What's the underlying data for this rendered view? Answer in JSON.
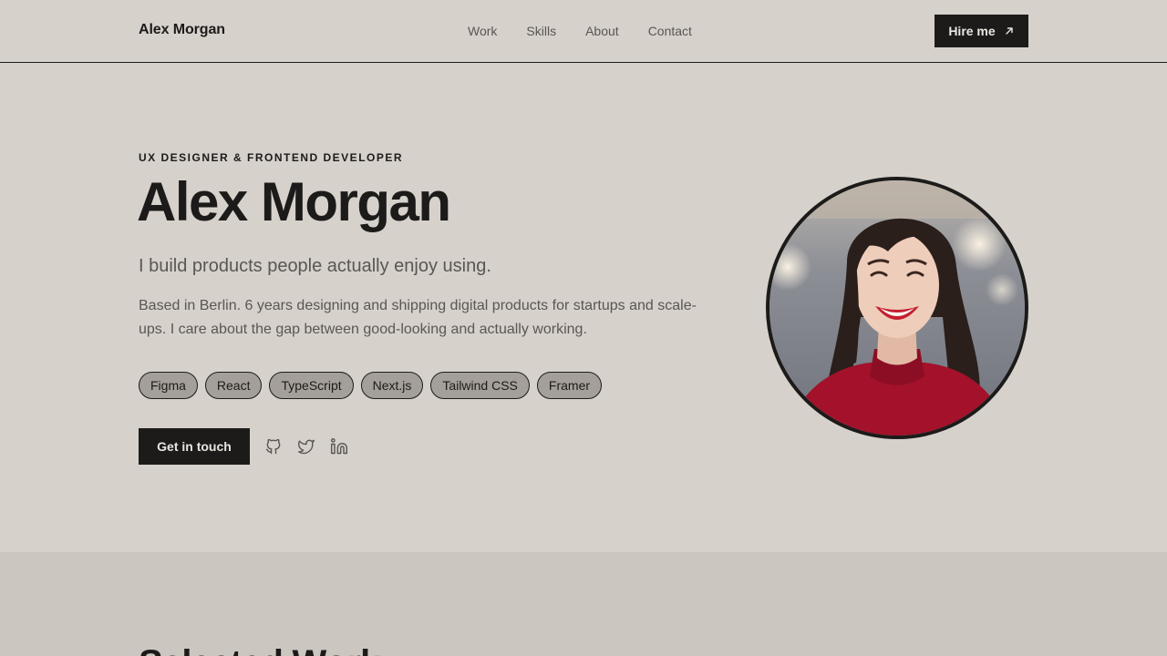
{
  "header": {
    "brand": "Alex Morgan",
    "nav": [
      "Work",
      "Skills",
      "About",
      "Contact"
    ],
    "cta_label": "Hire me",
    "cta_icon": "arrow-up-right-icon"
  },
  "hero": {
    "eyebrow": "UX DESIGNER & FRONTEND DEVELOPER",
    "title": "Alex Morgan",
    "tagline": "I build products people actually enjoy using.",
    "bio": "Based in Berlin. 6 years designing and shipping digital products for startups and scale-ups. I care about the gap between good-looking and actually working.",
    "skills": [
      "Figma",
      "React",
      "TypeScript",
      "Next.js",
      "Tailwind CSS",
      "Framer"
    ],
    "cta_label": "Get in touch",
    "socials": [
      "github-icon",
      "twitter-icon",
      "linkedin-icon"
    ]
  },
  "work": {
    "title": "Selected Work"
  },
  "colors": {
    "background": "#d6d1cb",
    "section_background": "#cbc6c0",
    "ink": "#1c1b1a",
    "muted": "#5a5652",
    "chip_fill": "#a49f99",
    "accent_red": "#a3112a"
  }
}
